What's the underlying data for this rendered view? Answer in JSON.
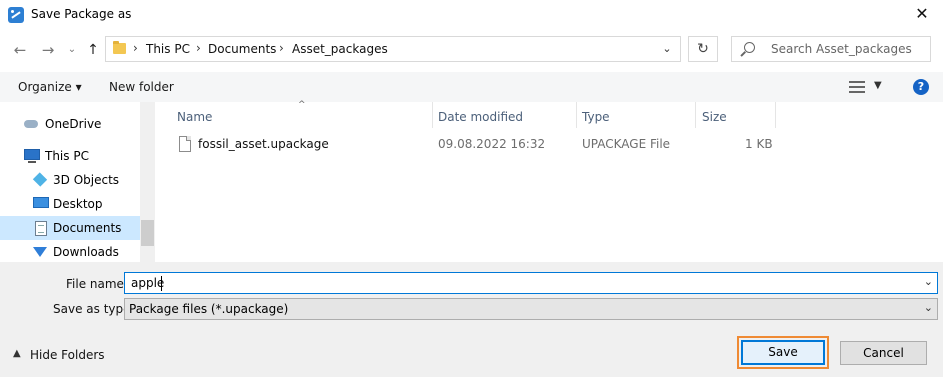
{
  "window": {
    "title": "Save Package as",
    "close_glyph": "✕"
  },
  "address": {
    "crumbs": [
      "This PC",
      "Documents",
      "Asset_packages"
    ],
    "search_placeholder": "Search Asset_packages"
  },
  "toolbar": {
    "organize": "Organize ▾",
    "new_folder": "New folder",
    "help": "?"
  },
  "sidebar": {
    "items": [
      {
        "label": "OneDrive",
        "icon": "cloud-icon"
      },
      {
        "label": "This PC",
        "icon": "computer-icon"
      },
      {
        "label": "3D Objects",
        "icon": "cube-icon"
      },
      {
        "label": "Desktop",
        "icon": "desktop-icon"
      },
      {
        "label": "Documents",
        "icon": "documents-icon",
        "selected": true
      },
      {
        "label": "Downloads",
        "icon": "download-icon"
      }
    ]
  },
  "list": {
    "columns": [
      "Name",
      "Date modified",
      "Type",
      "Size"
    ],
    "rows": [
      {
        "name": "fossil_asset.upackage",
        "date": "09.08.2022 16:32",
        "type": "UPACKAGE File",
        "size": "1 KB"
      }
    ]
  },
  "form": {
    "file_name_label": "File name:",
    "file_name_value": "apple",
    "save_type_label": "Save as type:",
    "save_type_value": "Package files (*.upackage)"
  },
  "footer": {
    "hide_folders": "Hide Folders",
    "save": "Save",
    "cancel": "Cancel"
  },
  "colors": {
    "accent": "#0078d7",
    "highlight": "#ef8a33",
    "selected_bg": "#cce8ff"
  }
}
